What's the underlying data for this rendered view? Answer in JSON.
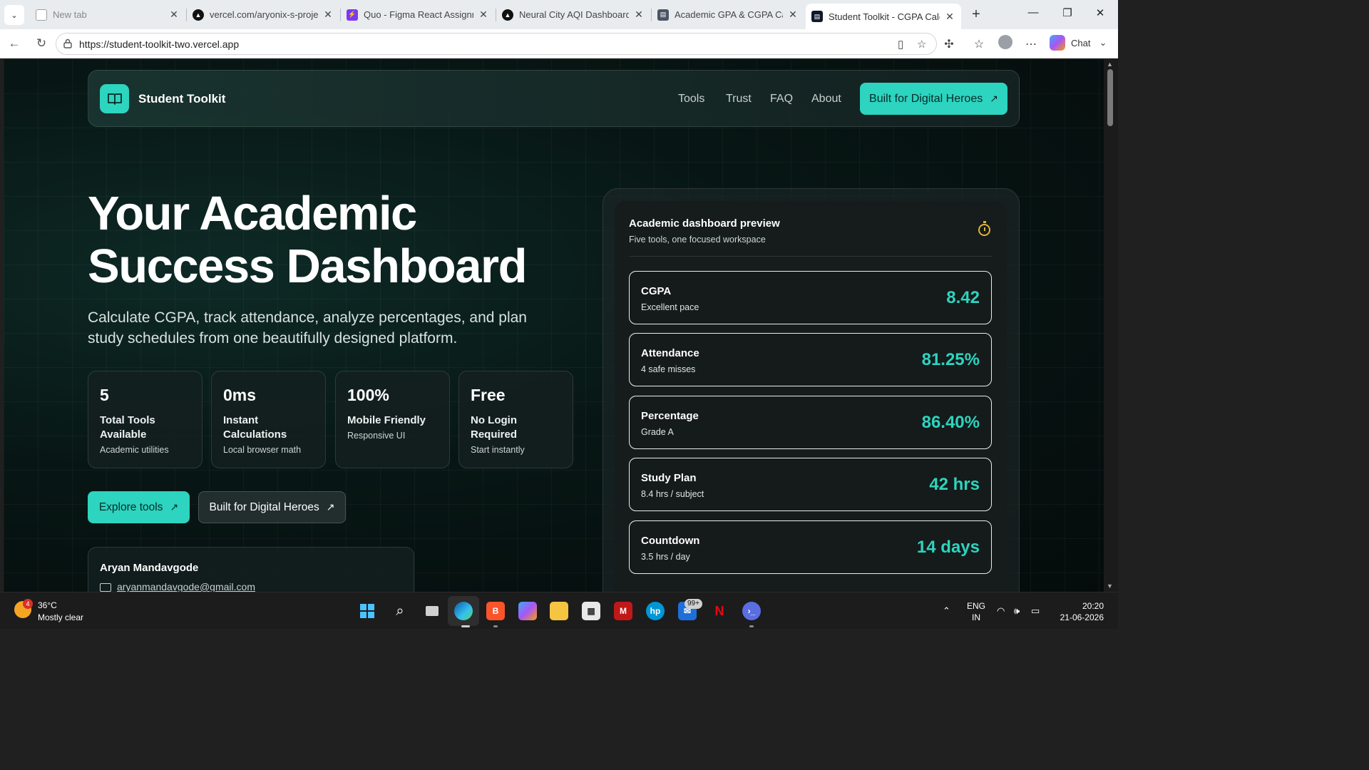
{
  "browser": {
    "tabs": [
      {
        "title": "New tab",
        "favicon": "new-tab-icon",
        "color": "#9aa0a6"
      },
      {
        "title": "vercel.com/aryonix-s-projects",
        "favicon": "vercel-icon",
        "color": "#111111"
      },
      {
        "title": "Quo - Figma React Assignment",
        "favicon": "quo-icon",
        "color": "#7c3aed"
      },
      {
        "title": "Neural City AQI Dashboard",
        "favicon": "vercel-icon",
        "color": "#111111"
      },
      {
        "title": "Academic GPA & CGPA Calculator",
        "favicon": "doc-icon",
        "color": "#4b5563"
      },
      {
        "title": "Student Toolkit - CGPA Calculator",
        "favicon": "toolkit-icon",
        "color": "#0f172a"
      }
    ],
    "url": "https://student-toolkit-two.vercel.app",
    "chat_label": "Chat"
  },
  "nav": {
    "brand": "Student Toolkit",
    "links": [
      "Tools",
      "Trust",
      "FAQ",
      "About"
    ],
    "cta": "Built for Digital Heroes"
  },
  "hero": {
    "title_line1": "Your Academic",
    "title_line2": "Success Dashboard",
    "subtitle": "Calculate CGPA, track attendance, analyze percentages, and plan study schedules from one beautifully designed platform.",
    "stats": [
      {
        "value": "5",
        "label": "Total Tools Available",
        "sub": "Academic utilities"
      },
      {
        "value": "0ms",
        "label": "Instant Calculations",
        "sub": "Local browser math"
      },
      {
        "value": "100%",
        "label": "Mobile Friendly",
        "sub": "Responsive UI"
      },
      {
        "value": "Free",
        "label": "No Login Required",
        "sub": "Start instantly"
      }
    ],
    "primary_button": "Explore tools",
    "secondary_button": "Built for Digital Heroes"
  },
  "author": {
    "name": "Aryan Mandavgode",
    "email": "aryanmandavgode@gmail.com"
  },
  "preview": {
    "title": "Academic dashboard preview",
    "subtitle": "Five tools, one focused workspace",
    "cards": [
      {
        "title": "CGPA",
        "sub": "Excellent pace",
        "value": "8.42"
      },
      {
        "title": "Attendance",
        "sub": "4 safe misses",
        "value": "81.25%"
      },
      {
        "title": "Percentage",
        "sub": "Grade A",
        "value": "86.40%"
      },
      {
        "title": "Study Plan",
        "sub": "8.4 hrs / subject",
        "value": "42 hrs"
      },
      {
        "title": "Countdown",
        "sub": "3.5 hrs / day",
        "value": "14 days"
      }
    ]
  },
  "taskbar": {
    "temperature": "36°C",
    "condition": "Mostly clear",
    "weather_badge": "4",
    "notif_badge": "99+",
    "lang_line1": "ENG",
    "lang_line2": "IN",
    "time": "20:20",
    "date": "21-06-2026"
  },
  "colors": {
    "accent": "#2dd4bf",
    "background": "#071614",
    "timer": "#e0b23a"
  }
}
